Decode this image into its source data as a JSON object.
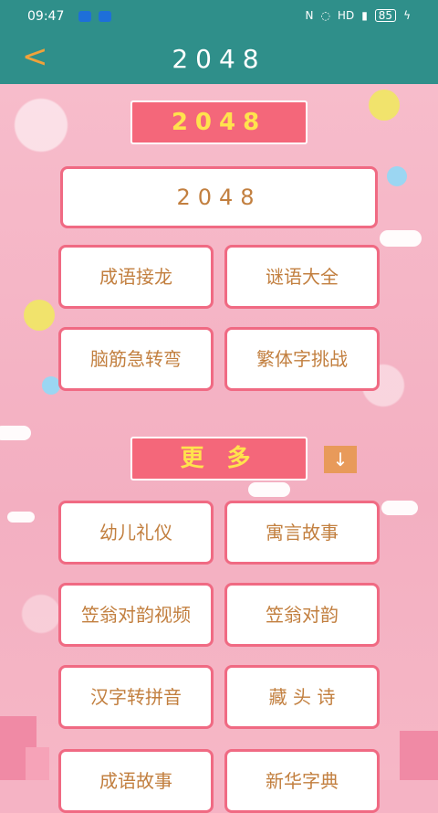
{
  "status_bar": {
    "time": "09:47",
    "network": "HD",
    "battery": "85"
  },
  "app_bar": {
    "back_glyph": "<",
    "title": "2048"
  },
  "sections": {
    "top_header": "2048",
    "featured": "2048",
    "grid1": [
      "成语接龙",
      "谜语大全",
      "脑筋急转弯",
      "繁体字挑战"
    ],
    "more_header": "更 多",
    "more_items": [
      "幼儿礼仪",
      "寓言故事",
      "笠翁对韵视频",
      "笠翁对韵",
      "汉字转拼音",
      "藏 头 诗",
      "成语故事",
      "新华字典"
    ]
  },
  "colors": {
    "appbar": "#2f8f8a",
    "accent_pink": "#f4677a",
    "button_text": "#c27f3f",
    "header_text": "#ffe34d"
  }
}
